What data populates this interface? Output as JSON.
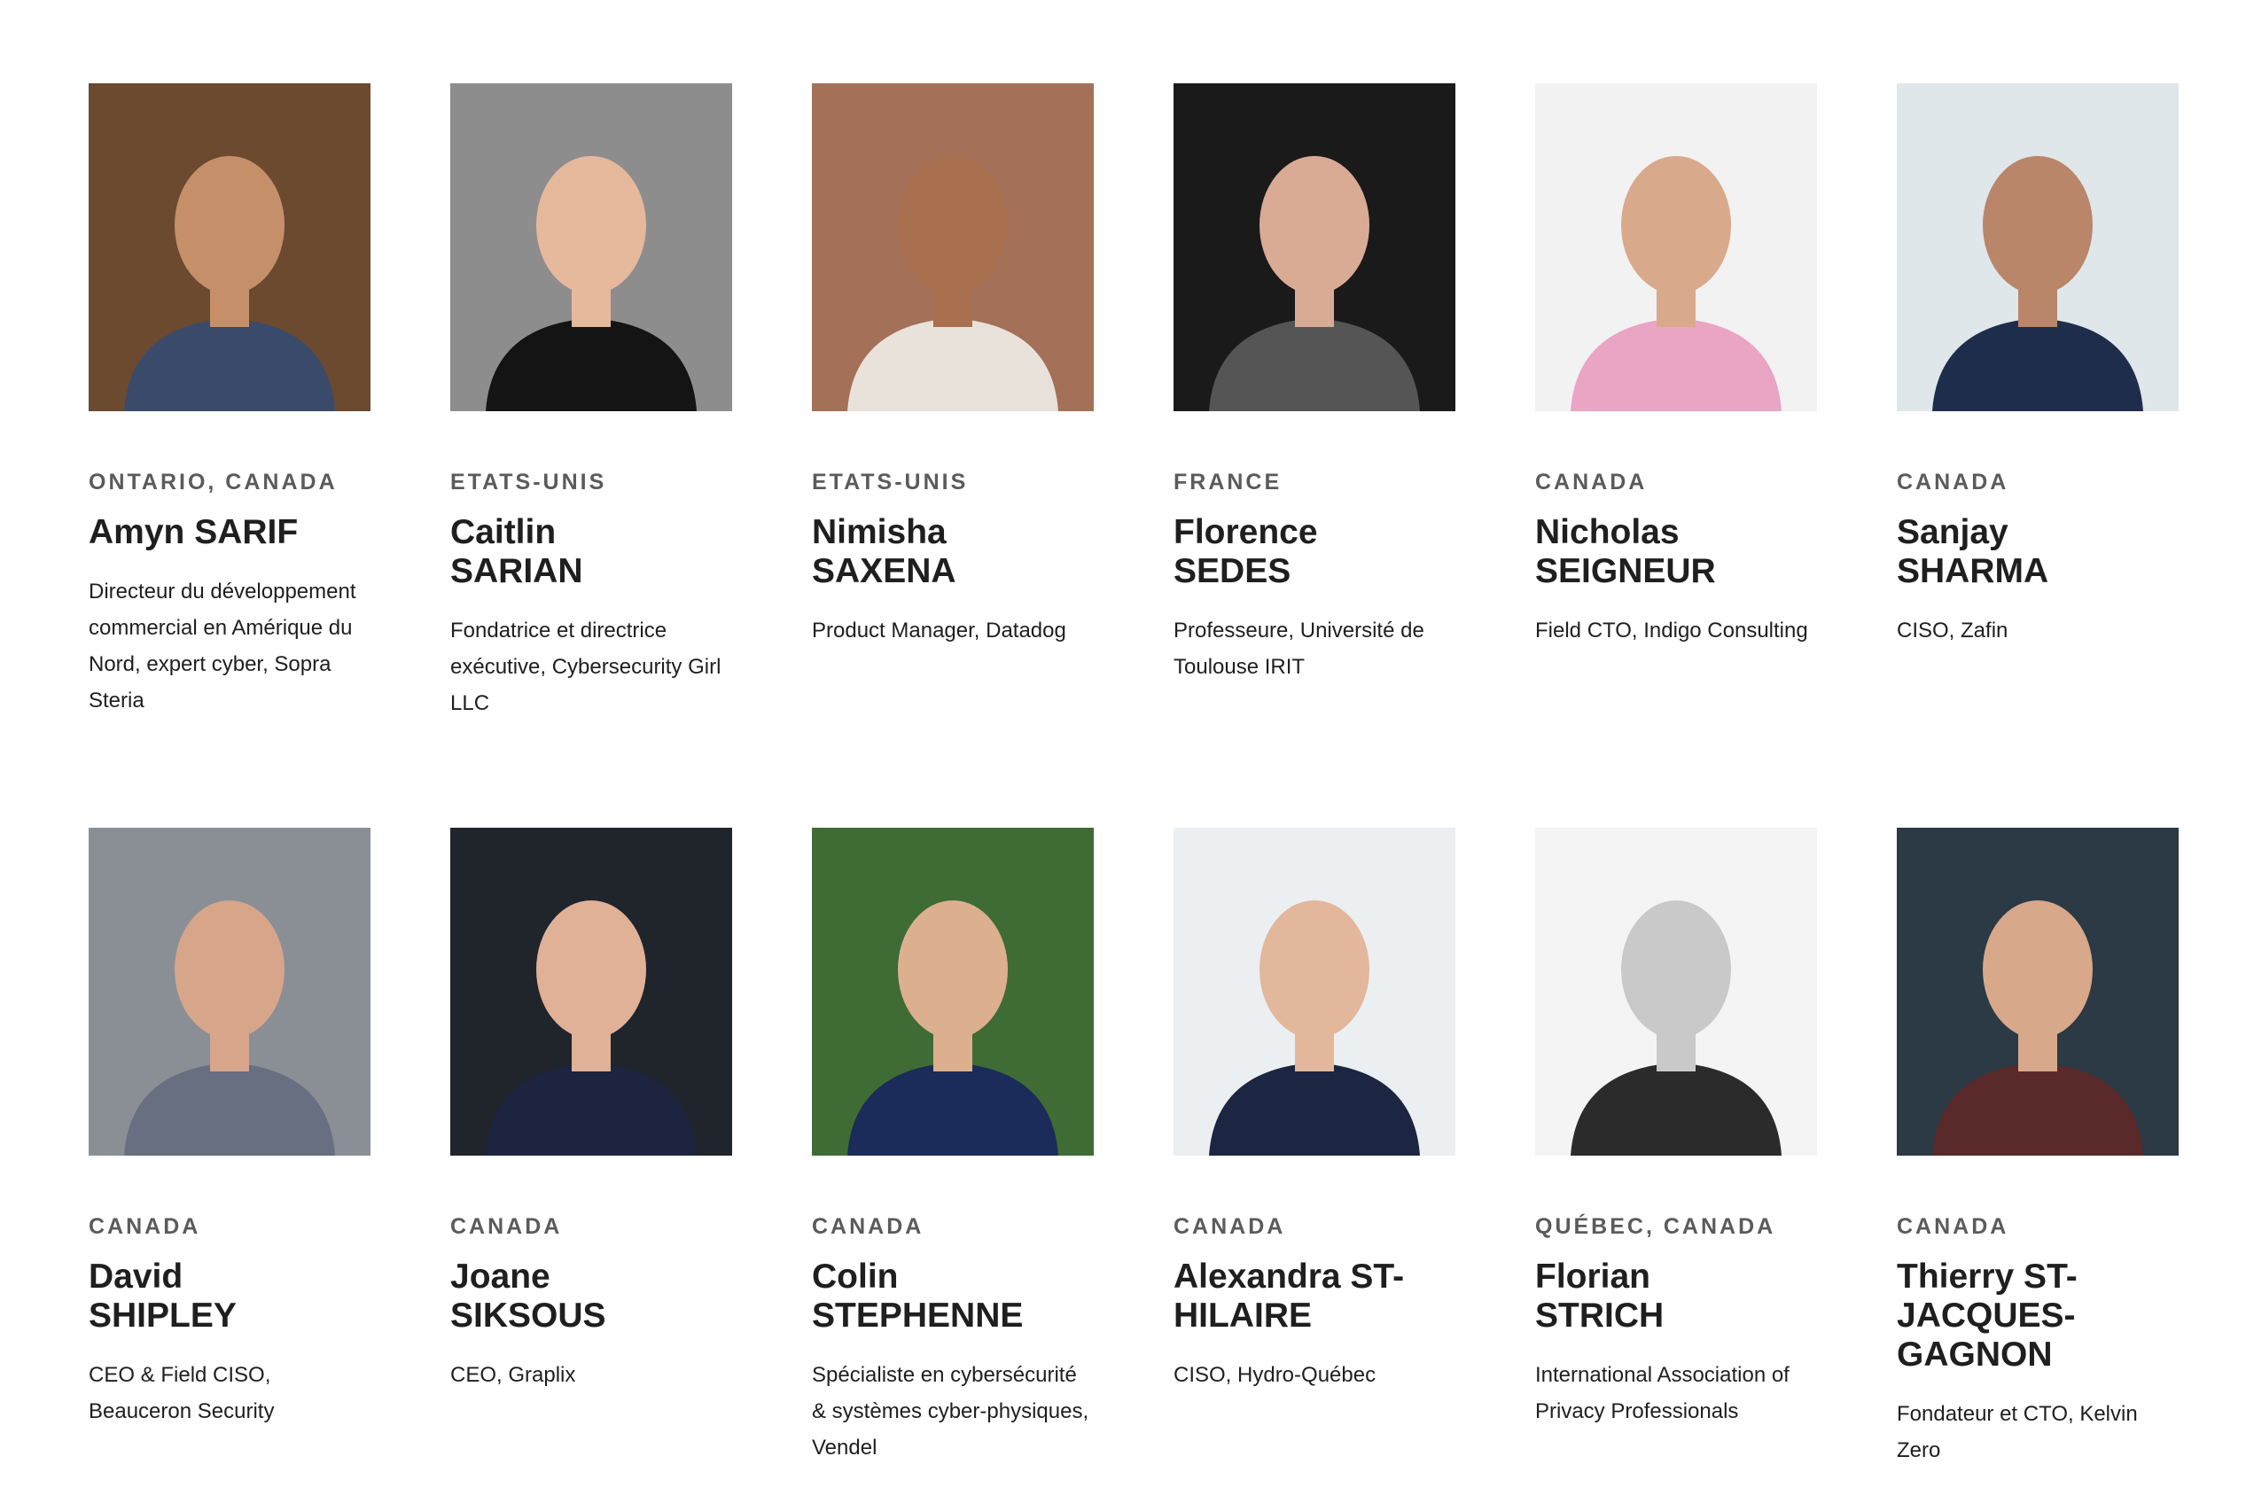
{
  "speakers": [
    {
      "location": "ONTARIO, CANADA",
      "first": "Amyn SARIF",
      "last": "",
      "role": "Directeur du développement commercial en Amérique du Nord, expert cyber, Sopra Steria",
      "bg": "#6b4a2f",
      "skin": "#c58f6a",
      "shirt": "#3a4a6b"
    },
    {
      "location": "ETATS-UNIS",
      "first": "Caitlin",
      "last": "SARIAN",
      "role": "Fondatrice et directrice exécutive, Cybersecurity Girl LLC",
      "bg": "#8d8d8d",
      "skin": "#e6b89c",
      "shirt": "#141414"
    },
    {
      "location": "ETATS-UNIS",
      "first": "Nimisha",
      "last": "SAXENA",
      "role": "Product Manager, Datadog",
      "bg": "#a47058",
      "skin": "#a8704e",
      "shirt": "#e8e2da"
    },
    {
      "location": "FRANCE",
      "first": "Florence",
      "last": "SEDES",
      "role": "Professeure, Université de Toulouse IRIT",
      "bg": "#1a1a1a",
      "skin": "#d9ab95",
      "shirt": "#555555"
    },
    {
      "location": "CANADA",
      "first": "Nicholas",
      "last": "SEIGNEUR",
      "role": "Field CTO, Indigo Consulting",
      "bg": "#f2f2f2",
      "skin": "#d9a98c",
      "shirt": "#e9a5c3"
    },
    {
      "location": "CANADA",
      "first": "Sanjay",
      "last": "SHARMA",
      "role": "CISO, Zafin",
      "bg": "#dfe7ea",
      "skin": "#b9866a",
      "shirt": "#1f2d4d"
    },
    {
      "location": "CANADA",
      "first": "David",
      "last": "SHIPLEY",
      "role": "CEO & Field CISO, Beauceron Security",
      "bg": "#8a8f96",
      "skin": "#d7a58a",
      "shirt": "#676f80"
    },
    {
      "location": "CANADA",
      "first": "Joane",
      "last": "SIKSOUS",
      "role": "CEO, Graplix",
      "bg": "#20252c",
      "skin": "#e0b197",
      "shirt": "#1c2440"
    },
    {
      "location": "CANADA",
      "first": "Colin",
      "last": "STEPHENNE",
      "role": "Spécialiste en cybersécurité & systèmes cyber-physiques, Vendel",
      "bg": "#3f6b35",
      "skin": "#dcb08f",
      "shirt": "#1b2b5a"
    },
    {
      "location": "CANADA",
      "first": "Alexandra ST-",
      "last": "HILAIRE",
      "role": "CISO, Hydro-Québec",
      "bg": "#eceff1",
      "skin": "#e2b79c",
      "shirt": "#1c2541"
    },
    {
      "location": "QUÉBEC, CANADA",
      "first": "Florian",
      "last": "STRICH",
      "role": "International Association of Privacy Professionals",
      "bg": "#f4f4f4",
      "skin": "#c9c9c9",
      "shirt": "#2b2b2b"
    },
    {
      "location": "CANADA",
      "first": "Thierry ST-",
      "last": "JACQUES-\nGAGNON",
      "role": "Fondateur et CTO, Kelvin Zero",
      "bg": "#2b3a44",
      "skin": "#d7a88a",
      "shirt": "#5a2a2a"
    }
  ]
}
